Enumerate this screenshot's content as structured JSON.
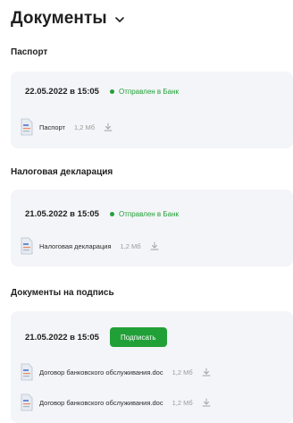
{
  "header": {
    "title": "Документы"
  },
  "passport": {
    "section_title": "Паспорт",
    "datetime": "22.05.2022 в 15:05",
    "status": "Отправлен в Банк",
    "file": {
      "name": "Паспорт",
      "size": "1,2 Мб"
    }
  },
  "tax": {
    "section_title": "Налоговая декларация",
    "datetime": "21.05.2022 в 15:05",
    "status": "Отправлен в Банк",
    "file": {
      "name": "Налоговая декларация",
      "size": "1,2 Мб"
    }
  },
  "sign": {
    "section_title": "Документы на подпись",
    "datetime": "21.05.2022 в 15:05",
    "button_label": "Подписать",
    "files": [
      {
        "name": "Договор банковского обслуживания.doc",
        "size": "1,2 Мб"
      },
      {
        "name": "Договор банковского обслуживания.doc",
        "size": "1,2 Мб"
      }
    ]
  },
  "colors": {
    "accent_green": "#21a038",
    "card_bg": "#f4f5f8"
  }
}
